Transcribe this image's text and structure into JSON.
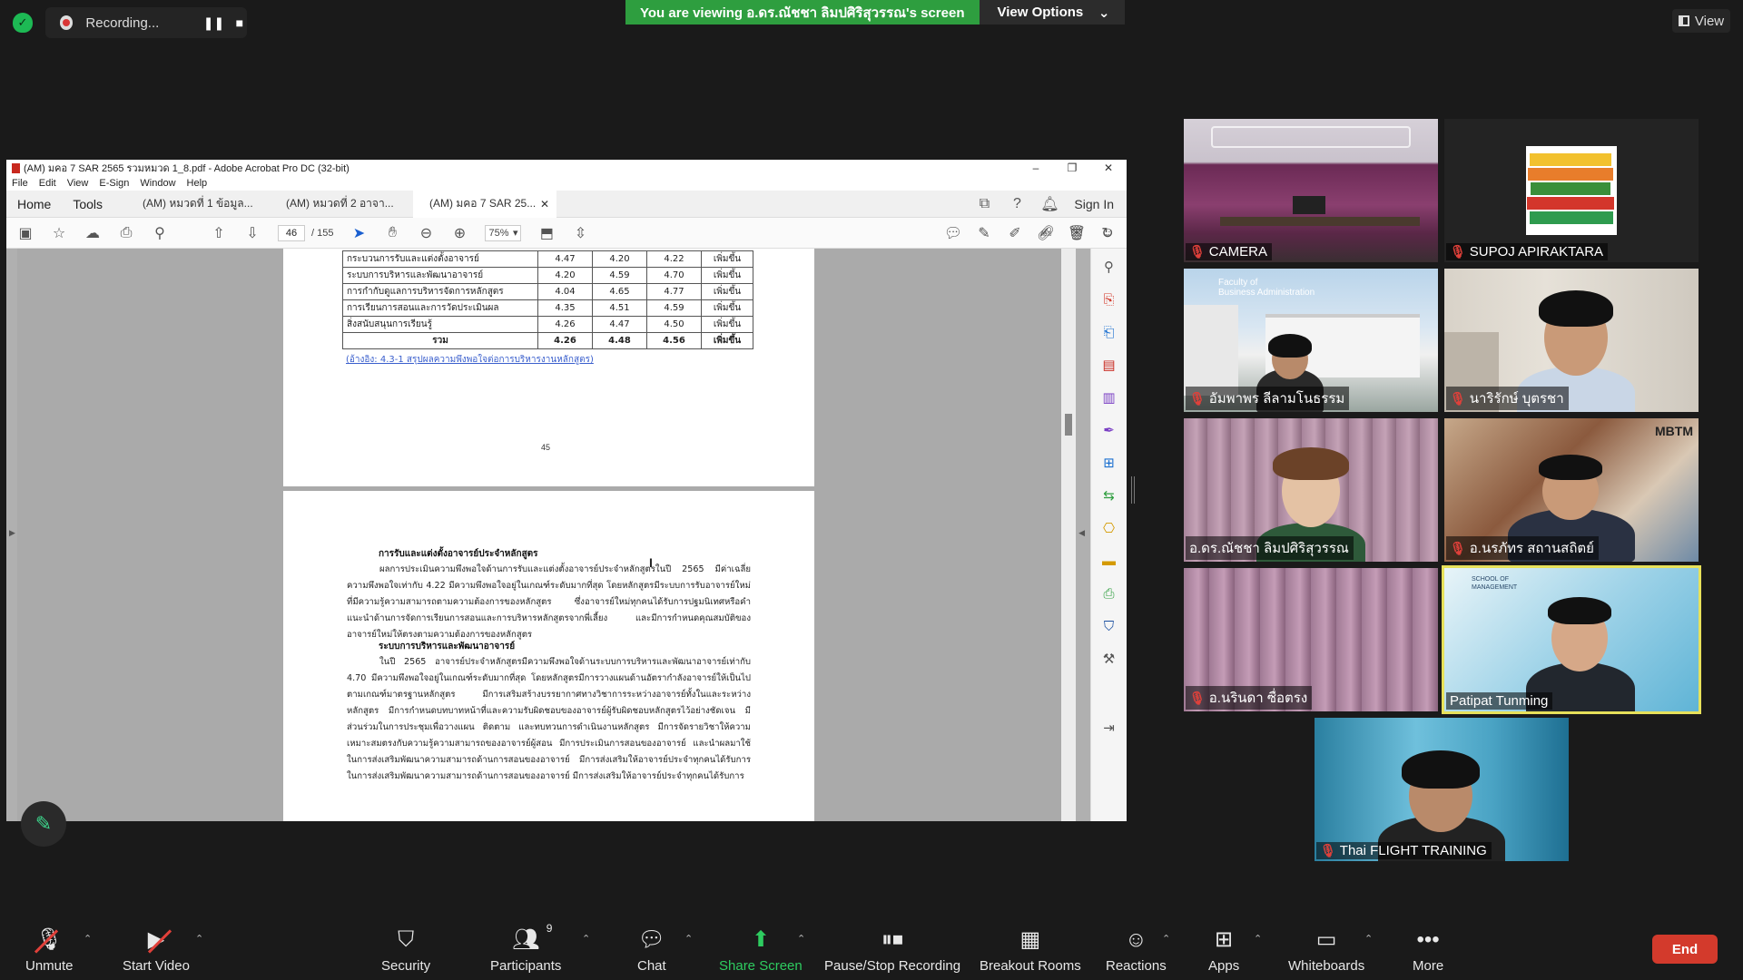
{
  "topbar": {
    "recording_label": "Recording...",
    "share_banner": "You are viewing อ.ดร.ณัชชา ลิมปศิริสุวรรณ's screen",
    "view_options": "View Options",
    "view_label": "View"
  },
  "acrobat": {
    "window_title": "(AM) มคอ 7 SAR 2565 รวมหมวด 1_8.pdf - Adobe Acrobat Pro DC (32-bit)",
    "menu": [
      "File",
      "Edit",
      "View",
      "E-Sign",
      "Window",
      "Help"
    ],
    "nav_home": "Home",
    "nav_tools": "Tools",
    "tabs": [
      "(AM) หมวดที่ 1 ข้อมูล...",
      "(AM) หมวดที่ 2 อาจา...",
      "(AM) มคอ 7 SAR 25..."
    ],
    "sign_in": "Sign In",
    "page_current": "46",
    "page_total": "/ 155",
    "zoom": "75%",
    "table_rows": [
      {
        "label": "กระบวนการรับและแต่งตั้งอาจารย์",
        "v1": "4.47",
        "v2": "4.20",
        "v3": "4.22",
        "trend": "เพิ่มขึ้น"
      },
      {
        "label": "ระบบการบริหารและพัฒนาอาจารย์",
        "v1": "4.20",
        "v2": "4.59",
        "v3": "4.70",
        "trend": "เพิ่มขึ้น"
      },
      {
        "label": "การกำกับดูแลการบริหารจัดการหลักสูตร",
        "v1": "4.04",
        "v2": "4.65",
        "v3": "4.77",
        "trend": "เพิ่มขึ้น"
      },
      {
        "label": "การเรียนการสอนและการวัดประเมินผล",
        "v1": "4.35",
        "v2": "4.51",
        "v3": "4.59",
        "trend": "เพิ่มขึ้น"
      },
      {
        "label": "สิ่งสนับสนุนการเรียนรู้",
        "v1": "4.26",
        "v2": "4.47",
        "v3": "4.50",
        "trend": "เพิ่มขึ้น"
      }
    ],
    "table_total": {
      "label": "รวม",
      "v1": "4.26",
      "v2": "4.48",
      "v3": "4.56",
      "trend": "เพิ่มขึ้น"
    },
    "ref_link": "(อ้างอิง: 4.3-1 สรุปผลความพึงพอใจต่อการบริหารงานหลักสูตร)",
    "page_number": "45",
    "heading1": "การรับและแต่งตั้งอาจารย์ประจำหลักสูตร",
    "para1": "ผลการประเมินความพึงพอใจด้านการรับและแต่งตั้งอาจารย์ประจำหลักสูตรในปี 2565 มีค่าเฉลี่ยความพึงพอใจเท่ากับ 4.22 มีความพึงพอใจอยู่ในเกณฑ์ระดับมากที่สุด โดยหลักสูตรมีระบบการรับอาจารย์ใหม่ที่มีความรู้ความสามารถตามความต้องการของหลักสูตร ซึ่งอาจารย์ใหม่ทุกคนได้รับการปฐมนิเทศหรือคำแนะนำด้านการจัดการเรียนการสอนและการบริหารหลักสูตรจากพี่เลี้ยง และมีการกำหนดคุณสมบัติของอาจารย์ใหม่ให้ตรงตามความต้องการของหลักสูตร",
    "heading2": "ระบบการบริหารและพัฒนาอาจารย์",
    "para2": "ในปี 2565 อาจารย์ประจำหลักสูตรมีความพึงพอใจด้านระบบการบริหารและพัฒนาอาจารย์เท่ากับ 4.70 มีความพึงพอใจอยู่ในเกณฑ์ระดับมากที่สุด โดยหลักสูตรมีการวางแผนด้านอัตรากำลังอาจารย์ให้เป็นไปตามเกณฑ์มาตรฐานหลักสูตร มีการเสริมสร้างบรรยากาศทางวิชาการระหว่างอาจารย์ทั้งในและระหว่างหลักสูตร มีการกำหนดบทบาทหน้าที่และความรับผิดชอบของอาจารย์ผู้รับผิดชอบหลักสูตรไว้อย่างชัดเจน มีส่วนร่วมในการประชุมเพื่อวางแผน ติดตาม และทบทวนการดำเนินงานหลักสูตร มีการจัดรายวิชาให้ความเหมาะสมตรงกับความรู้ความสามารถของอาจารย์ผู้สอน มีการประเมินการสอนของอาจารย์ และนำผลมาใช้ในการส่งเสริมพัฒนาความสามารถด้านการสอนของอาจารย์ มีการส่งเสริมให้อาจารย์ประจำทุกคนได้รับการ ในการส่งเสริมพัฒนาความสามารถด้านการสอนของอาจารย์ มีการส่งเสริมให้อาจารย์ประจำทุกคนได้รับการ"
  },
  "gallery": [
    {
      "name": "CAMERA",
      "muted": true
    },
    {
      "name": "SUPOJ APIRAKTARA",
      "muted": true
    },
    {
      "name": "อัมพาพร ลีลามโนธรรม",
      "muted": true,
      "bg_text1": "Faculty of",
      "bg_text2": "Business Administration"
    },
    {
      "name": "นาริรักษ์ บุตรชา",
      "muted": true
    },
    {
      "name": "อ.ดร.ณัชชา ลิมปศิริสุวรรณ",
      "muted": false
    },
    {
      "name": "อ.นรภัทร สถานสถิตย์",
      "muted": true,
      "bg_text1": "MBTM"
    },
    {
      "name": "อ.นรินดา ซื่อตรง",
      "muted": true
    },
    {
      "name": "Patipat Tunming",
      "muted": false,
      "active": true,
      "bg_text1": "SCHOOL OF",
      "bg_text2": "MANAGEMENT"
    },
    {
      "name": "Thai FLIGHT TRAINING",
      "muted": true
    }
  ],
  "toolbar": {
    "unmute": "Unmute",
    "start_video": "Start Video",
    "security": "Security",
    "participants": "Participants",
    "participant_count": "9",
    "chat": "Chat",
    "share_screen": "Share Screen",
    "pause_stop_recording": "Pause/Stop Recording",
    "breakout_rooms": "Breakout Rooms",
    "reactions": "Reactions",
    "apps": "Apps",
    "whiteboards": "Whiteboards",
    "more": "More",
    "end": "End"
  },
  "colors": {
    "zoom_green": "#2e9e3f",
    "end_red": "#d33a2c",
    "active_speaker": "#e7e15a",
    "mute_red": "#e0403a"
  }
}
